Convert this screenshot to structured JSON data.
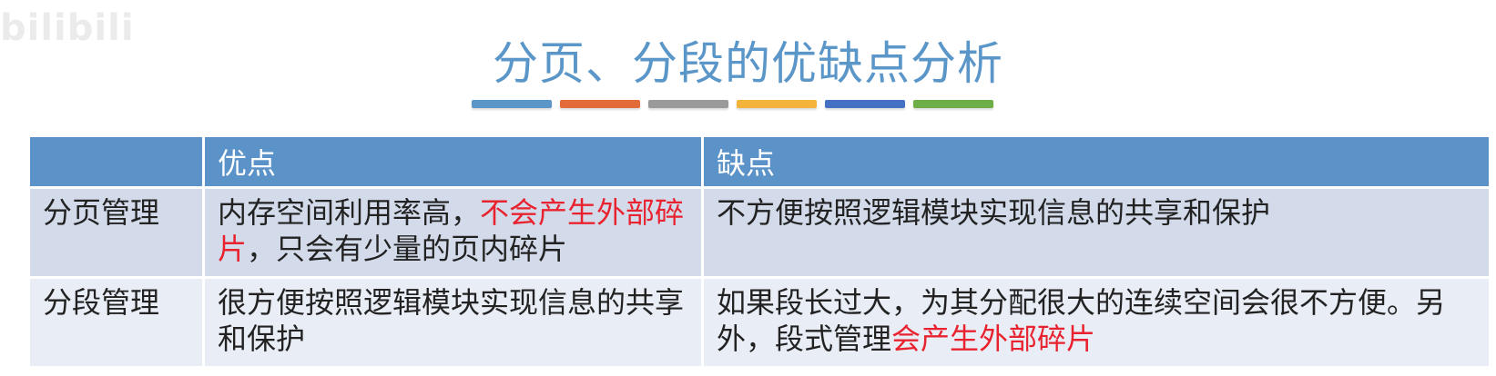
{
  "watermark": "bilibili",
  "title": "分页、分段的优缺点分析",
  "colors": {
    "title": "#5b96c9",
    "header_bg": "#5b92c8",
    "row1_bg": "#d3dbea",
    "row2_bg": "#e9edf5",
    "highlight_red": "#e8232f",
    "title_bar": [
      "#5b96c9",
      "#e36b3a",
      "#9a9a9a",
      "#f4b43c",
      "#4471c4",
      "#6eae47"
    ]
  },
  "table": {
    "headers": [
      "",
      "优点",
      "缺点"
    ],
    "rows": [
      {
        "label": "分页管理",
        "advantage": {
          "before": "内存空间利用率高，",
          "highlight": "不会产生外部碎片",
          "after": "，只会有少量的页内碎片"
        },
        "disadvantage": {
          "before": "不方便按照逻辑模块实现信息的共享和保护",
          "highlight": "",
          "after": ""
        }
      },
      {
        "label": "分段管理",
        "advantage": {
          "before": "很方便按照逻辑模块实现信息的共享和保护",
          "highlight": "",
          "after": ""
        },
        "disadvantage": {
          "before": "如果段长过大，为其分配很大的连续空间会很不方便。另外，段式管理",
          "highlight": "会产生外部碎片",
          "after": ""
        }
      }
    ]
  }
}
